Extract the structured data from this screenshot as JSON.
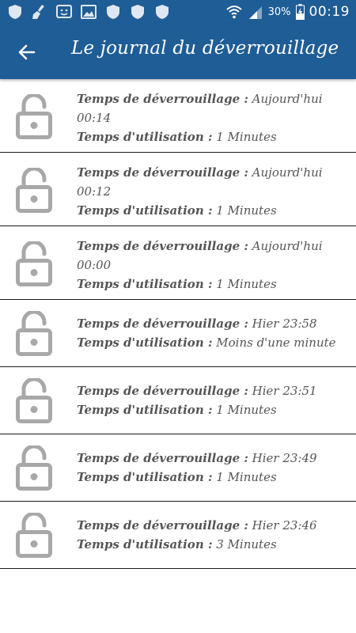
{
  "status_bar": {
    "battery_percent": "30%",
    "time": "00:19",
    "notification_icons": [
      "shield-icon",
      "broom-icon",
      "face-icon",
      "image-icon",
      "shield-icon",
      "shield-icon",
      "shield-icon"
    ]
  },
  "header": {
    "title": "Le journal du déverrouillage",
    "back_icon": "arrow-left-icon"
  },
  "labels": {
    "unlock_time": "Temps de déverrouillage :",
    "usage_time": "Temps d'utilisation :"
  },
  "entries": [
    {
      "unlock_time_line1": "Aujourd'hui",
      "unlock_time_line2": "00:14",
      "usage_time": "1 Minutes"
    },
    {
      "unlock_time_line1": "Aujourd'hui",
      "unlock_time_line2": "00:12",
      "usage_time": "1 Minutes"
    },
    {
      "unlock_time_line1": "Aujourd'hui",
      "unlock_time_line2": "00:00",
      "usage_time": "1 Minutes"
    },
    {
      "unlock_time_line1": "Hier 23:58",
      "usage_time": "Moins d'une minute"
    },
    {
      "unlock_time_line1": "Hier 23:51",
      "usage_time": "1 Minutes"
    },
    {
      "unlock_time_line1": "Hier 23:49",
      "usage_time": "1 Minutes"
    },
    {
      "unlock_time_line1": "Hier 23:46",
      "usage_time": "3 Minutes"
    }
  ],
  "colors": {
    "header_bg": "#1f5d96",
    "lock_icon": "#a8a8a8",
    "text": "#555555",
    "divider": "#1a1a1a"
  }
}
